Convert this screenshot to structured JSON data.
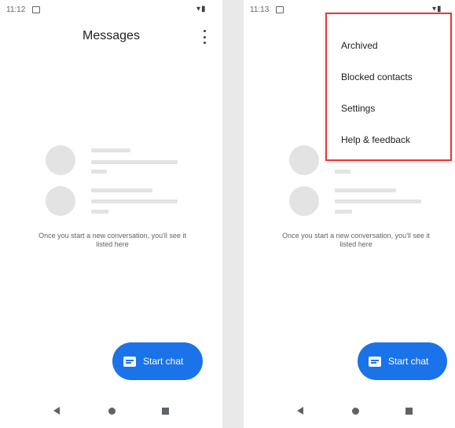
{
  "left_screen": {
    "status": {
      "time": "11:12",
      "icons": "▾▮"
    },
    "title": "Messages",
    "empty_state": {
      "message": "Once you start a new conversation, you'll see it listed here"
    },
    "fab": {
      "label": "Start chat"
    }
  },
  "right_screen": {
    "status": {
      "time": "11:13",
      "icons": "▾▮"
    },
    "menu": {
      "items": [
        {
          "label": "Archived"
        },
        {
          "label": "Blocked contacts"
        },
        {
          "label": "Settings"
        },
        {
          "label": "Help & feedback"
        }
      ],
      "highlight_color": "#e53935"
    },
    "empty_state": {
      "message": "Once you start a new conversation, you'll see it listed here"
    },
    "fab": {
      "label": "Start chat"
    }
  },
  "colors": {
    "accent": "#1a73e8",
    "placeholder": "#e3e3e3",
    "text_secondary": "#5f6368"
  },
  "icons": {
    "overflow": "more-vert-icon",
    "fab": "message-icon",
    "nav": [
      "back-icon",
      "home-icon",
      "recents-icon"
    ]
  }
}
